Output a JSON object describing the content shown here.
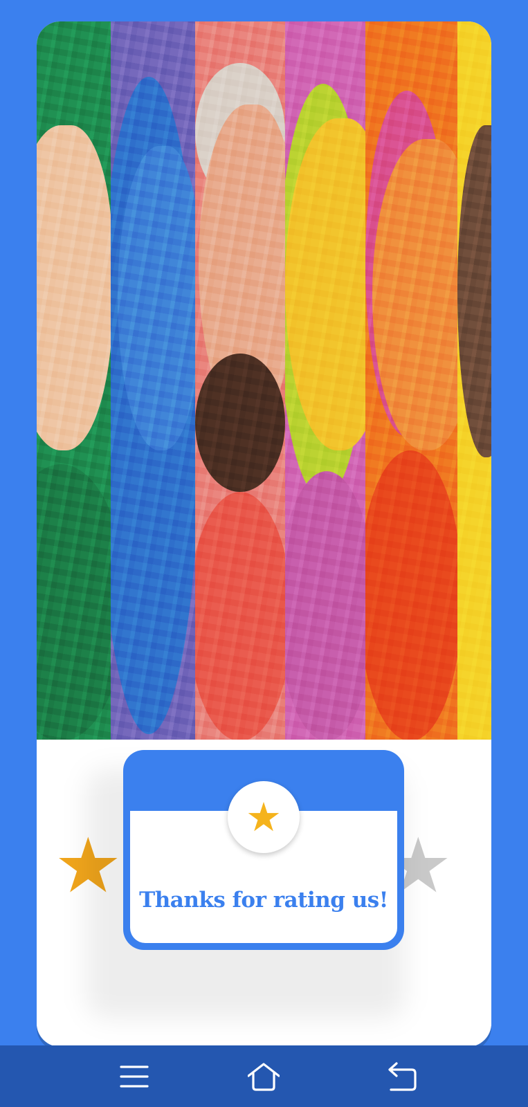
{
  "dialog": {
    "message": "Thanks for rating us!",
    "badge_icon": "star-icon"
  },
  "rating": {
    "left_star_icon": "star-filled-icon",
    "right_star_icon": "star-empty-icon",
    "filled_color": "#f0a51c",
    "empty_color": "#c9c9c9"
  },
  "artwork": {
    "stripe_colors": [
      "#1e8a4e",
      "#2f6fcb",
      "#e97f78",
      "#f2c22a",
      "#ef6a1e",
      "#f5d228"
    ]
  },
  "navigation": {
    "buttons": [
      "menu-icon",
      "home-icon",
      "back-icon"
    ]
  },
  "colors": {
    "background": "#3b80ee",
    "accent": "#3b80ee",
    "star": "#f5b31c",
    "navbar": "#2457b0"
  }
}
